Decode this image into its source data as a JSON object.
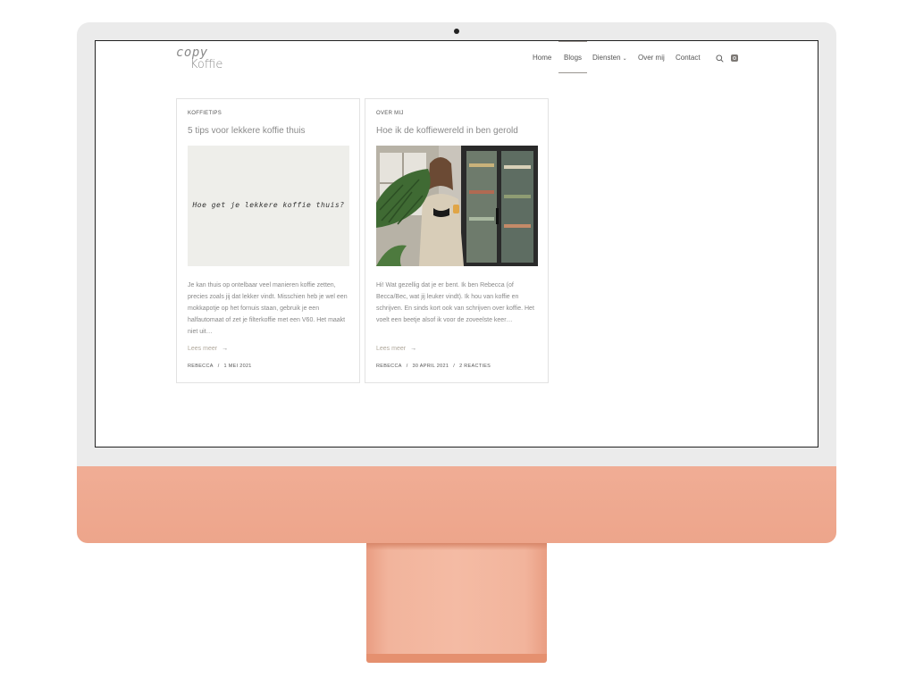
{
  "site": {
    "logo_top": "copy",
    "logo_bottom": "Koffie"
  },
  "nav": {
    "items": [
      {
        "label": "Home"
      },
      {
        "label": "Blogs",
        "active": true
      },
      {
        "label": "Diensten",
        "has_dropdown": true
      },
      {
        "label": "Over mij"
      },
      {
        "label": "Contact"
      }
    ],
    "search_icon": "search-icon",
    "social_icon": "instagram-icon"
  },
  "posts": [
    {
      "category": "KOFFIETIPS",
      "title": "5 tips voor lekkere koffie thuis",
      "image_text": "Hoe get je lekkere koffie thuis?",
      "excerpt": "Je kan thuis op ontelbaar veel manieren koffie zetten, precies zoals jij dat lekker vindt. Misschien heb je wel een mokkapotje op het fornuis staan, gebruik je een halfautomaat of zet je filterkoffie met een V60. Het maakt niet uit…",
      "read_more": "Lees meer",
      "author": "REBECCA",
      "date": "1 MEI 2021"
    },
    {
      "category": "OVER MIJ",
      "title": "Hoe ik de koffiewereld in ben gerold",
      "excerpt": "Hi! Wat gezellig dat je er bent. Ik ben Rebecca (of Becca/Bec, wat jij leuker vindt). Ik hou van koffie en schrijven. En sinds kort ook van schrijven over koffie. Het voelt een beetje alsof ik voor de zoveelste keer…",
      "read_more": "Lees meer",
      "author": "REBECCA",
      "date": "30 APRIL 2021",
      "comments": "2 REACTIES"
    }
  ],
  "colors": {
    "device_accent": "#eda58b",
    "device_frame": "#ebebeb",
    "text_muted": "#8a8a8a",
    "link": "#b0a89c"
  }
}
